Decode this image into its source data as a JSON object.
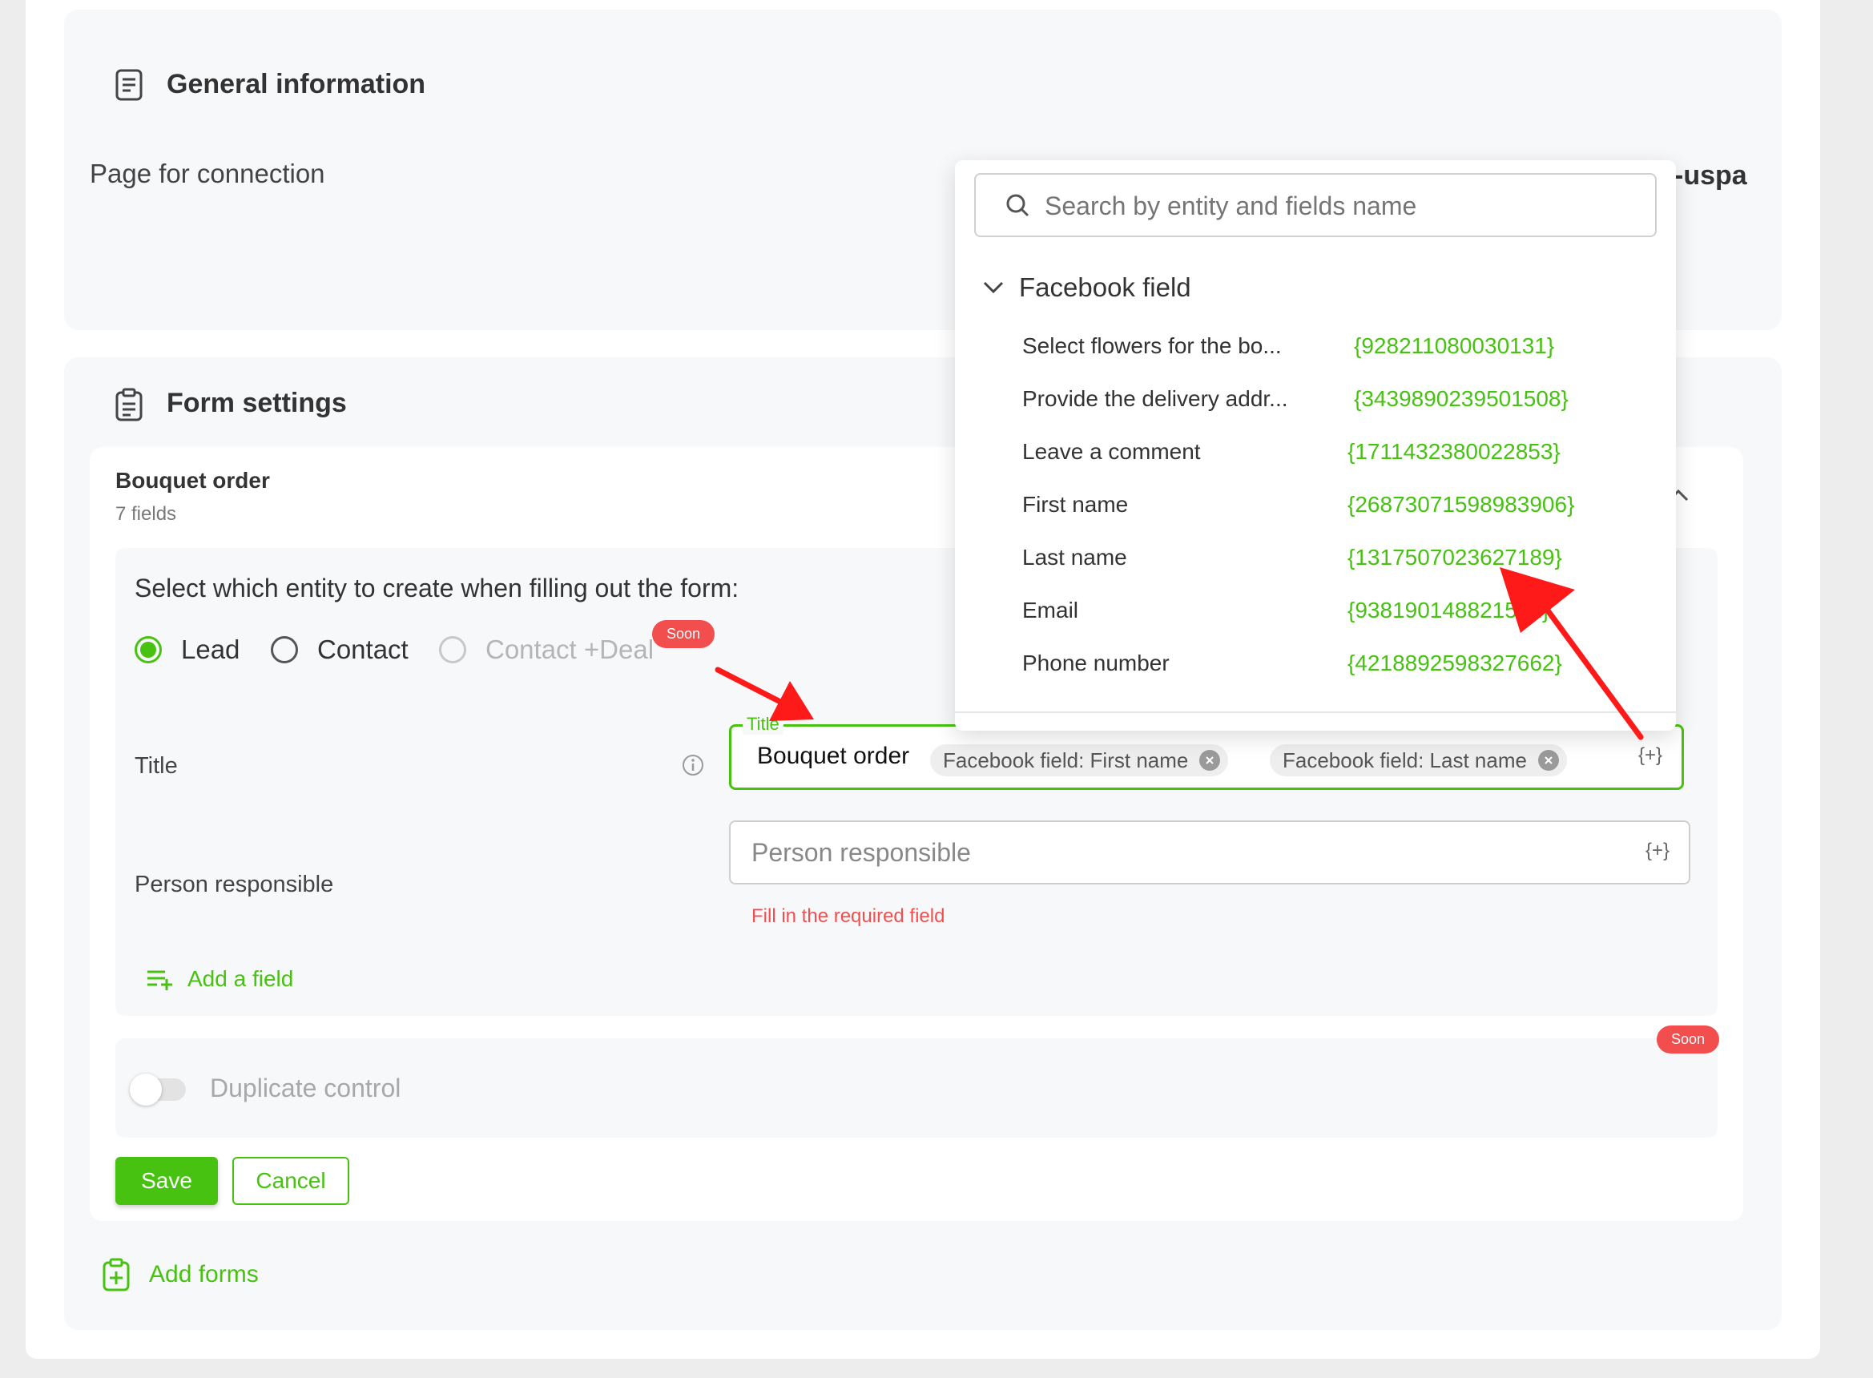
{
  "general": {
    "title": "General information",
    "page_label": "Page for connection",
    "page_value_partial": "-uspa"
  },
  "form_settings": {
    "title": "Form settings",
    "form_name": "Bouquet order",
    "form_fields_count": "7 fields",
    "entity_prompt": "Select which entity to create when filling out the form:",
    "entities": [
      {
        "label": "Lead",
        "selected": true
      },
      {
        "label": "Contact",
        "selected": false
      },
      {
        "label": "Contact +Deal",
        "selected": false,
        "disabled": true
      }
    ],
    "soon_label": "Soon",
    "title_row": {
      "label": "Title",
      "float_label": "Title",
      "text": "Bouquet order",
      "chips": [
        "Facebook field: First name",
        "Facebook field: Last name"
      ],
      "insert_token": "{+}"
    },
    "person_row": {
      "label": "Person responsible",
      "placeholder": "Person responsible",
      "insert_token": "{+}",
      "error": "Fill in the required field"
    },
    "add_field_label": "Add a field",
    "duplicate_label": "Duplicate control",
    "duplicate_soon_label": "Soon",
    "save_label": "Save",
    "cancel_label": "Cancel",
    "add_forms_label": "Add forms"
  },
  "dropdown": {
    "search_placeholder": "Search by entity and fields name",
    "group_label": "Facebook field",
    "items": [
      {
        "label": "Select flowers for the bo...",
        "token": "{928211080030131}"
      },
      {
        "label": "Provide the delivery addr...",
        "token": "{3439890239501508}"
      },
      {
        "label": "Leave a comment",
        "token": "{1711432380022853}"
      },
      {
        "label": "First name",
        "token": "{26873071598983906}"
      },
      {
        "label": "Last name",
        "token": "{1317507023627189}"
      },
      {
        "label": "Email",
        "token": "{938190148821521}"
      },
      {
        "label": "Phone number",
        "token": "{4218892598327662}"
      }
    ]
  },
  "colors": {
    "accent": "#47c211",
    "error": "#f24e4e",
    "arrow": "#ff1a1a"
  }
}
